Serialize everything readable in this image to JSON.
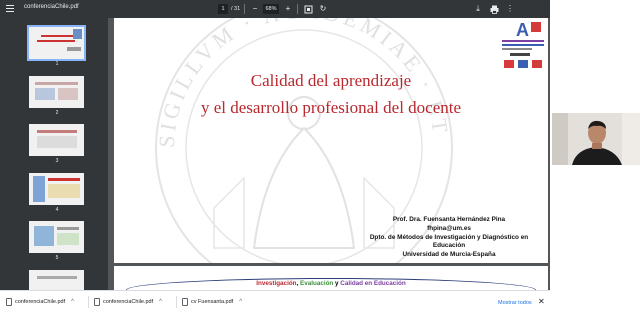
{
  "toolbar": {
    "file_name": "conferenciaChile.pdf",
    "current_page": "1",
    "page_total": "/ 31",
    "zoom": "68%",
    "menu_icon": "hamburger-menu-icon",
    "zoom_out_icon": "minus-icon",
    "zoom_in_icon": "plus-icon",
    "fit_icon": "fit-page-icon",
    "rotate_icon": "rotate-icon",
    "download_icon": "download-icon",
    "print_icon": "print-icon",
    "more_icon": "more-vert-icon"
  },
  "sidebar": {
    "thumbnails": [
      {
        "page": "1",
        "selected": true
      },
      {
        "page": "2",
        "selected": false
      },
      {
        "page": "3",
        "selected": false
      },
      {
        "page": "4",
        "selected": false
      },
      {
        "page": "5",
        "selected": false
      },
      {
        "page": "6",
        "selected": false
      }
    ]
  },
  "slide": {
    "title_line1": "Calidad del aprendizaje",
    "title_line2": "y el desarrollo profesional del docente",
    "author_name": "Prof. Dra. Fuensanta Hernández Pina",
    "author_email": "fhpina@um.es",
    "author_dept_line1": "Dpto. de Métodos de Investigación y Diagnóstico en",
    "author_dept_line2": "Educación",
    "author_university": "Universidad de Murcia-España",
    "seal_text": "SIGILLVM · ACADEMIAE · ET · ST · STVDIORVM · MVRCIAE"
  },
  "slide2": {
    "tag1": "Investigación",
    "tag_sep1": ", ",
    "tag2": "Evaluación",
    "tag_sep2": " y ",
    "tag3": "Calidad en Educación",
    "colors": {
      "tag1": "#b8282e",
      "tag2": "#3c8f3c",
      "tag3": "#7a3fa0"
    }
  },
  "downloads": {
    "items": [
      {
        "name": "conferenciaChile.pdf"
      },
      {
        "name": "conferenciaChile.pdf"
      },
      {
        "name": "cv Fuensanta.pdf"
      }
    ],
    "show_all": "Mostrar todos",
    "close_icon": "close-icon"
  }
}
